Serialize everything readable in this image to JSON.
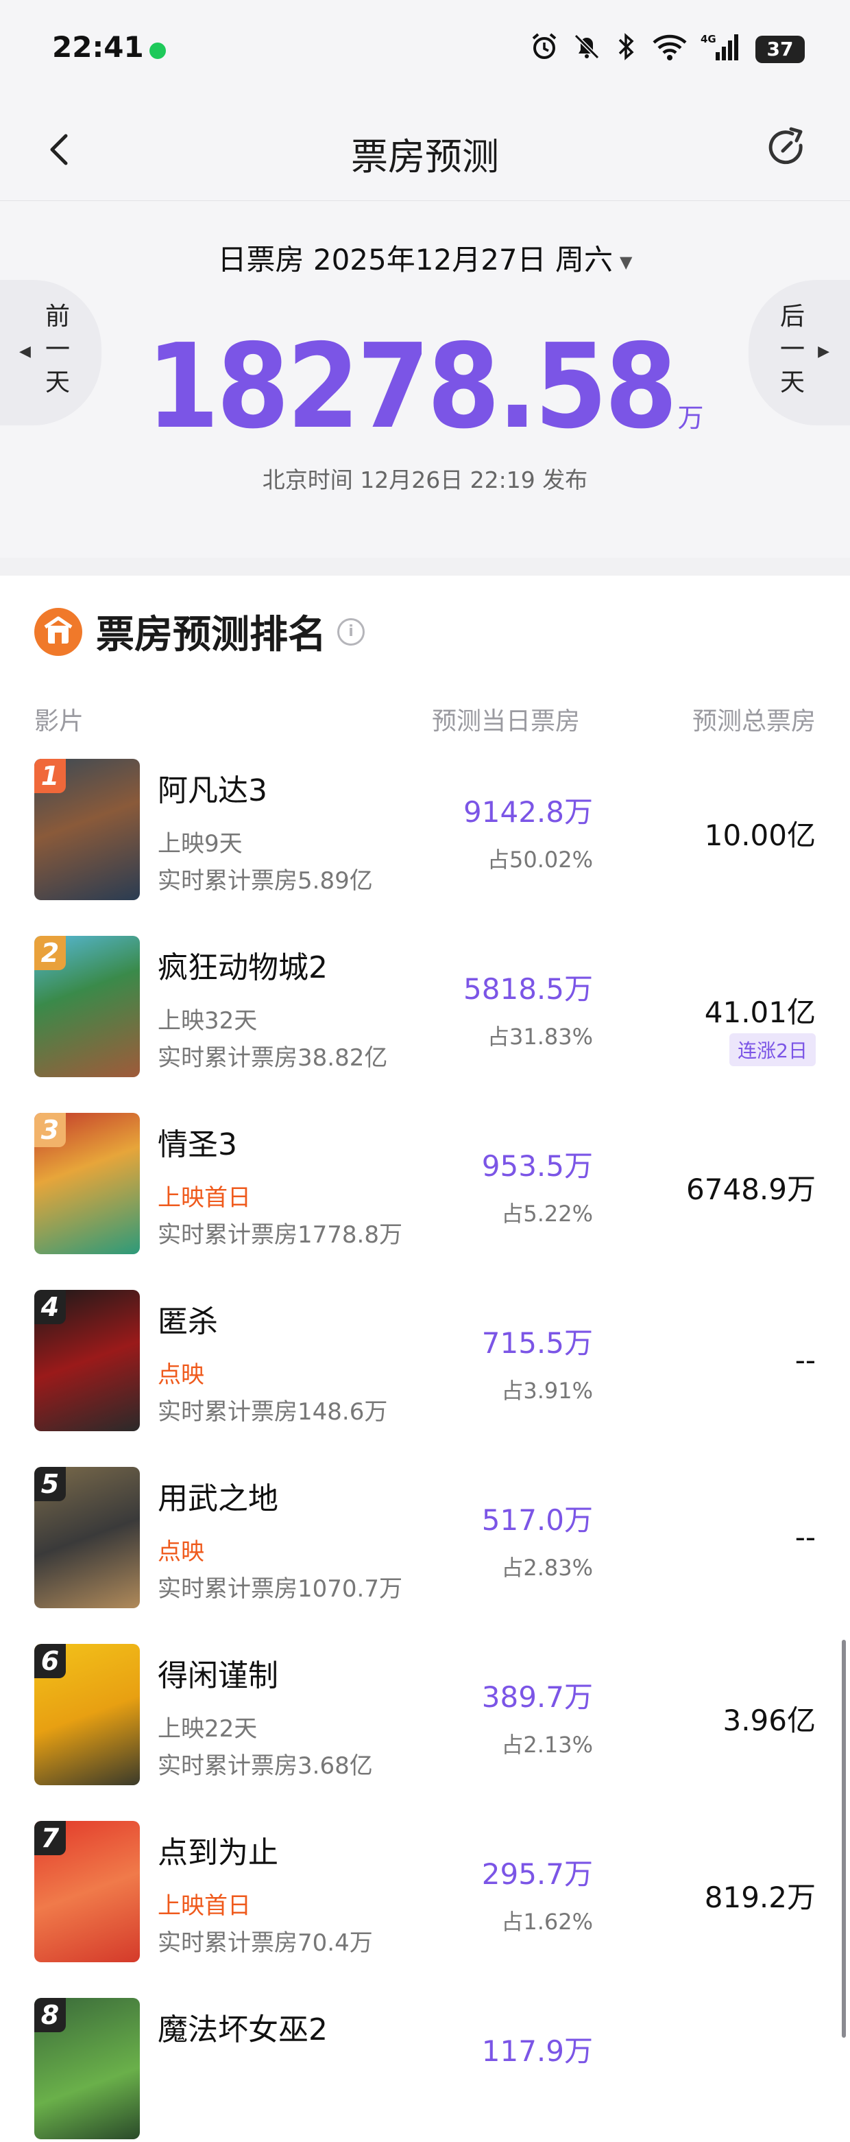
{
  "status_bar": {
    "time": "22:41",
    "battery": "37",
    "network": "4G"
  },
  "nav": {
    "title": "票房预测"
  },
  "header": {
    "date_label": "日票房 2025年12月27日 周六",
    "prev_day": "前一天",
    "next_day": "后一天",
    "total_value": "18278.58",
    "total_unit": "万",
    "publish_time": "北京时间 12月26日 22:19 发布"
  },
  "ranking": {
    "title": "票房预测排名",
    "columns": {
      "film": "影片",
      "day": "预测当日票房",
      "total": "预测总票房"
    },
    "films": [
      {
        "rank": "1",
        "name": "阿凡达3",
        "meta": "上映9天",
        "highlight": false,
        "cumulative": "实时累计票房5.89亿",
        "day": "9142.8万",
        "share": "占50.02%",
        "total": "10.00亿",
        "tag": "",
        "badge_color": "#f0683a"
      },
      {
        "rank": "2",
        "name": "疯狂动物城2",
        "meta": "上映32天",
        "highlight": false,
        "cumulative": "实时累计票房38.82亿",
        "day": "5818.5万",
        "share": "占31.83%",
        "total": "41.01亿",
        "tag": "连涨2日",
        "badge_color": "#e9a13b"
      },
      {
        "rank": "3",
        "name": "情圣3",
        "meta": "上映首日",
        "highlight": true,
        "cumulative": "实时累计票房1778.8万",
        "day": "953.5万",
        "share": "占5.22%",
        "total": "6748.9万",
        "tag": "",
        "badge_color": "#f2b36a"
      },
      {
        "rank": "4",
        "name": "匿杀",
        "meta": "点映",
        "highlight": true,
        "cumulative": "实时累计票房148.6万",
        "day": "715.5万",
        "share": "占3.91%",
        "total": "--",
        "tag": "",
        "badge_color": "#222222"
      },
      {
        "rank": "5",
        "name": "用武之地",
        "meta": "点映",
        "highlight": true,
        "cumulative": "实时累计票房1070.7万",
        "day": "517.0万",
        "share": "占2.83%",
        "total": "--",
        "tag": "",
        "badge_color": "#222222"
      },
      {
        "rank": "6",
        "name": "得闲谨制",
        "meta": "上映22天",
        "highlight": false,
        "cumulative": "实时累计票房3.68亿",
        "day": "389.7万",
        "share": "占2.13%",
        "total": "3.96亿",
        "tag": "",
        "badge_color": "#222222"
      },
      {
        "rank": "7",
        "name": "点到为止",
        "meta": "上映首日",
        "highlight": true,
        "cumulative": "实时累计票房70.4万",
        "day": "295.7万",
        "share": "占1.62%",
        "total": "819.2万",
        "tag": "",
        "badge_color": "#222222"
      },
      {
        "rank": "8",
        "name": "魔法坏女巫2",
        "meta": "",
        "highlight": false,
        "cumulative": "",
        "day": "117.9万",
        "share": "",
        "total": "",
        "tag": "",
        "badge_color": "#222222"
      }
    ]
  }
}
